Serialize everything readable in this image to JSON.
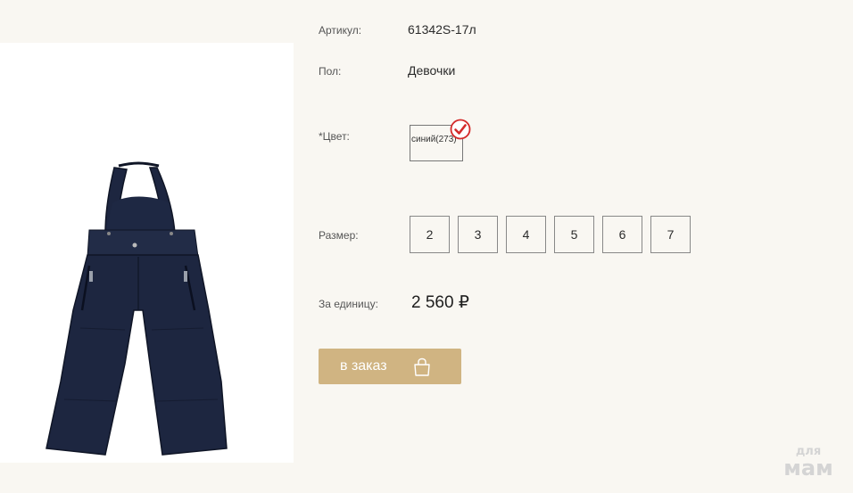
{
  "product": {
    "article_label": "Артикул:",
    "article_value": "61342S-17л",
    "gender_label": "Пол:",
    "gender_value": "Девочки",
    "color_label": "*Цвет:",
    "color_option": "синий(273)",
    "size_label": "Размер:",
    "sizes": [
      "2",
      "3",
      "4",
      "5",
      "6",
      "7"
    ],
    "price_label": "За единицу:",
    "price_value": "2 560 ₽",
    "order_button": "в заказ"
  },
  "image": {
    "subject": "navy children's winter overalls",
    "garment_color": "#1d2640"
  },
  "watermark": {
    "line1": "для",
    "line2": "мам"
  },
  "colors": {
    "background": "#f9f7f2",
    "accent": "#d0b482",
    "check": "#d42a2a"
  }
}
